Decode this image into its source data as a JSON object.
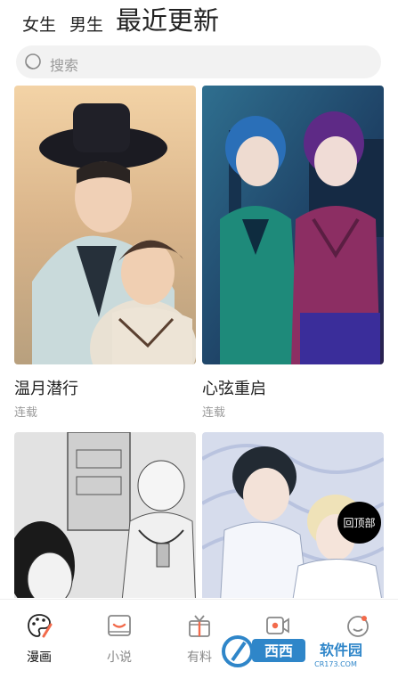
{
  "header": {
    "tabs": [
      {
        "label": "女生"
      },
      {
        "label": "男生"
      },
      {
        "label": "最近更新"
      }
    ]
  },
  "search": {
    "placeholder": "搜索"
  },
  "comics": [
    {
      "title": "温月潜行",
      "status": "连载"
    },
    {
      "title": "心弦重启",
      "status": "连载"
    },
    {
      "title": "",
      "status": ""
    },
    {
      "title": "",
      "status": ""
    }
  ],
  "back_to_top": {
    "label": "回顶部"
  },
  "bottom_nav": {
    "items": [
      {
        "label": "漫画",
        "icon": "palette-icon"
      },
      {
        "label": "小说",
        "icon": "book-icon"
      },
      {
        "label": "有料",
        "icon": "gift-icon"
      },
      {
        "label": "",
        "icon": "video-icon"
      },
      {
        "label": "",
        "icon": "profile-icon"
      }
    ]
  },
  "watermark": {
    "brand": "西西软件园",
    "url": "CR173.COM"
  },
  "colors": {
    "accent": "#f26a4b",
    "text_primary": "#222222",
    "text_secondary": "#9a9a9a",
    "search_bg": "#f2f2f2"
  }
}
